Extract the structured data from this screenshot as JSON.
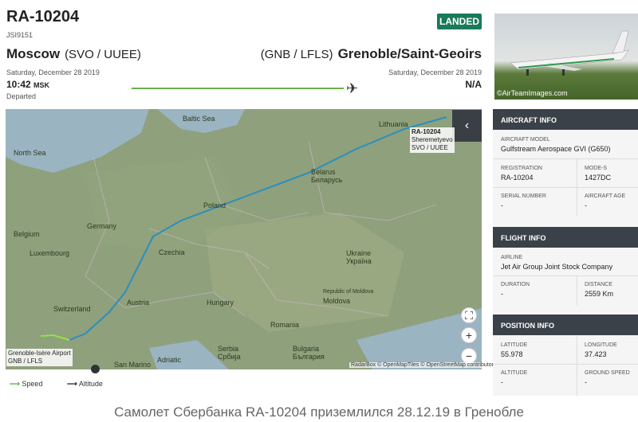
{
  "header": {
    "callsign": "RA-10204",
    "flight_number": "JSI9151",
    "status": "LANDED",
    "origin_city": "Moscow",
    "origin_code": "(SVO / UUEE)",
    "dest_city": "Grenoble/Saint-Geoirs",
    "dest_code": "(GNB / LFLS)",
    "dep_date": "Saturday, December 28 2019",
    "arr_date": "Saturday, December 28 2019",
    "dep_time": "10:42",
    "dep_tz": "MSK",
    "dep_status": "Departed",
    "arr_time": "N/A",
    "progress_fraction": 0.95
  },
  "photo": {
    "credit": "©AirTeamImages.com"
  },
  "map": {
    "labels": [
      "Baltic Sea",
      "North Sea",
      "Germany",
      "Poland",
      "Belarus\nБеларусь",
      "Czechia",
      "Austria",
      "Hungary",
      "Romania",
      "Switzerland",
      "Belgium",
      "Luxembourg",
      "Ukraine\nУкраїна",
      "Moldova",
      "Republic of Moldova",
      "Serbia\nСрбија",
      "Bulgaria\nБългария",
      "San Marino",
      "Lithuania",
      "Adriatic"
    ],
    "airport_tag": [
      "Grenoble-Isère Airport",
      "GNB / LFLS"
    ],
    "aircraft_tag": [
      "RA-10204",
      "Sheremetyevo",
      "SVO / UUEE"
    ],
    "attribution": "RadarBox © OpenMapTiles © OpenStreetMap contributors",
    "collapse_icon": "chevron-left-icon"
  },
  "legend": {
    "speed": "Speed",
    "altitude": "Altitude"
  },
  "aircraft_info": {
    "title": "AIRCRAFT INFO",
    "model_label": "AIRCRAFT MODEL",
    "model": "Gulfstream Aerospace GVI (G650)",
    "reg_label": "REGISTRATION",
    "reg": "RA-10204",
    "modes_label": "MODE-S",
    "modes": "1427DC",
    "serial_label": "SERIAL NUMBER",
    "serial": "-",
    "age_label": "AIRCRAFT AGE",
    "age": "-"
  },
  "flight_info": {
    "title": "FLIGHT INFO",
    "airline_label": "AIRLINE",
    "airline": "Jet Air Group Joint Stock Company",
    "duration_label": "DURATION",
    "duration": "-",
    "distance_label": "DISTANCE",
    "distance": "2559 Km"
  },
  "position_info": {
    "title": "POSITION INFO",
    "lat_label": "LATITUDE",
    "lat": "55.978",
    "lon_label": "LONGITUDE",
    "lon": "37.423",
    "alt_label": "ALTITUDE",
    "alt": "-",
    "gs_label": "GROUND SPEED",
    "gs": "-"
  },
  "caption": "Самолет Сбербанка  RA-10204 приземлился 28.12.19 в Гренобле"
}
